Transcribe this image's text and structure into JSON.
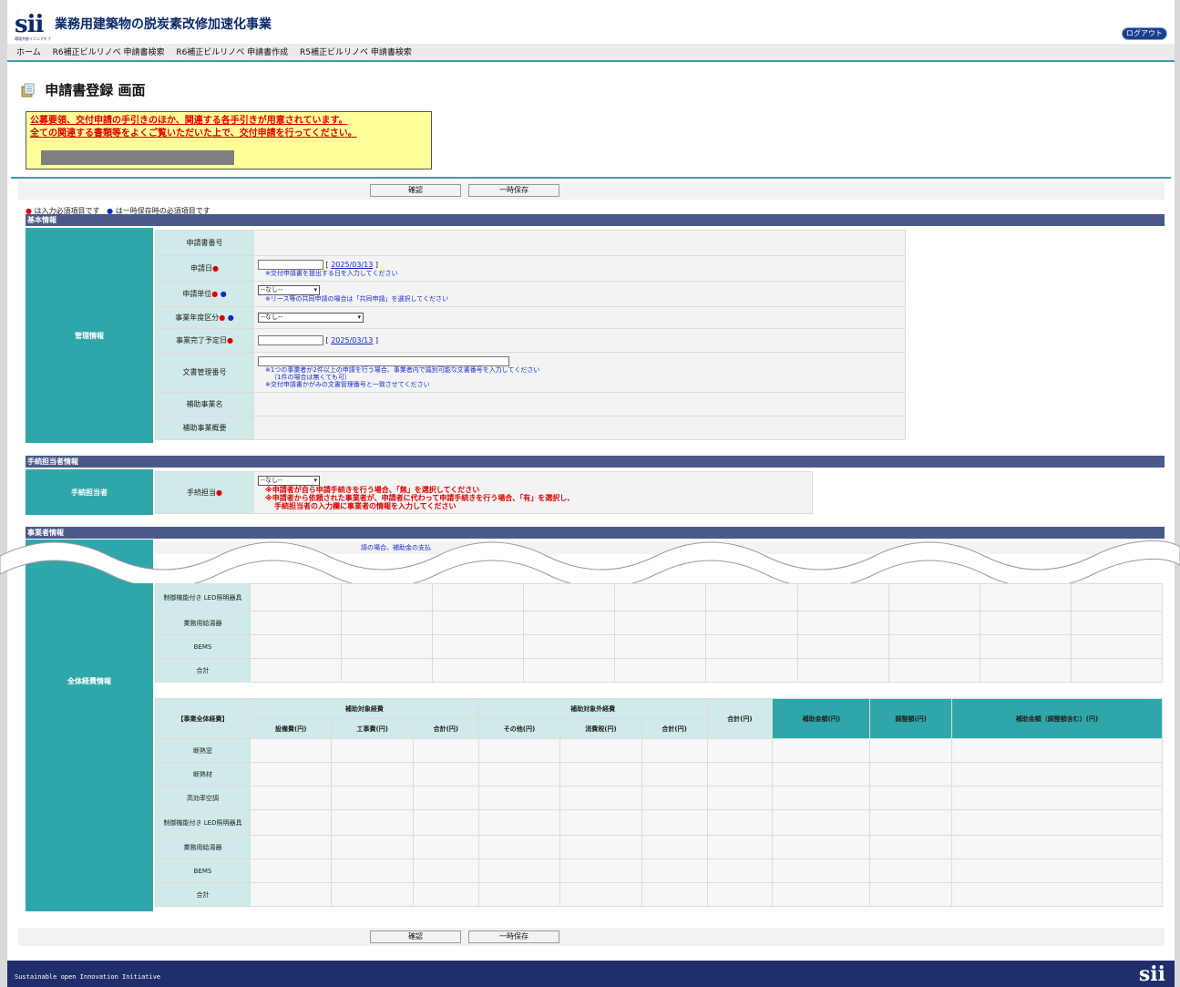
{
  "header": {
    "logo_mark": "sii",
    "logo_sub": "環境共創イニシアチブ",
    "site_title": "業務用建築物の脱炭素改修加速化事業",
    "logout": "ログアウト"
  },
  "nav": [
    "ホーム",
    "R6補正ビルリノベ 申請書検索",
    "R6補正ビルリノベ 申請書作成",
    "R5補正ビルリノベ 申請書検索"
  ],
  "page_title": "申請書登録 画面",
  "notice": {
    "line1": "公募要領、交付申請の手引きのほか、関連する各手引きが用意されています。",
    "line2": "全ての関連する書類等をよくご覧いただいた上で、交付申請を行ってください。"
  },
  "buttons": {
    "confirm": "確認",
    "save_temp": "一時保存"
  },
  "legend": {
    "required": "は入力必須項目です",
    "temp_required": "は一時保存時の必須項目です",
    "mark": "●"
  },
  "basic": {
    "section": "基本情報",
    "group": "管理情報",
    "fields": {
      "app_no": "申請書番号",
      "app_date": "申請日",
      "app_date_value": "2025/03/13",
      "app_date_hint": "※交付申請書を提出する日を入力してください",
      "unit": "申請単位",
      "unit_select": "--なし--",
      "unit_hint": "※リース等の共同申請の場合は「共同申請」を選択してください",
      "year": "事業年度区分",
      "year_select": "--なし--",
      "complete": "事業完了予定日",
      "complete_value": "2025/03/13",
      "doc_no": "文書管理番号",
      "doc_hint1": "※1つの事業者が2件以上の申請を行う場合、事業者内で識別可能な文書番号を入力してください",
      "doc_hint2": "（1件の場合は無くても可）",
      "doc_hint3": "※交付申請書かがみの文書管理番号と一致させてください",
      "project_name": "補助事業名",
      "project_summary": "補助事業概要"
    }
  },
  "proc": {
    "section": "手続担当者情報",
    "group": "手続担当者",
    "label": "手続担当",
    "select": "--なし--",
    "hint1": "※申請者が自ら申請手続きを行う場合、「無」を選択してください",
    "hint2": "※申請者から依頼された事業者が、申請者に代わって申請手続きを行う場合、「有」を選択し、",
    "hint3": "手続担当者の入力欄に事業者の情報を入力してください"
  },
  "biz": {
    "section": "事業者情報",
    "partial": "請の場合、補助金の支払"
  },
  "cost": {
    "group": "全体経費情報",
    "table_title": "【事業全体経費】",
    "h_subsidized": "補助対象経費",
    "h_unsubsidized": "補助対象外経費",
    "h_equip": "設備費(円)",
    "h_work": "工事費(円)",
    "h_sum": "合計(円)",
    "h_other": "その他(円)",
    "h_tax": "消費税(円)",
    "h_total": "合計(円)",
    "h_subsidy": "補助金額(円)",
    "h_adjust": "調整額(円)",
    "h_subsidy_adj": "補助金額（調整額含む）(円)",
    "rows_upper": [
      "制御機能付き LED照明器具",
      "業務用給湯器",
      "BEMS",
      "合計"
    ],
    "rows": [
      "断熱窓",
      "断熱材",
      "高効率空調",
      "制御機能付き LED照明器具",
      "業務用給湯器",
      "BEMS",
      "合計"
    ]
  },
  "footer": {
    "text": "Sustainable open Innovation Initiative",
    "mark": "sii"
  }
}
